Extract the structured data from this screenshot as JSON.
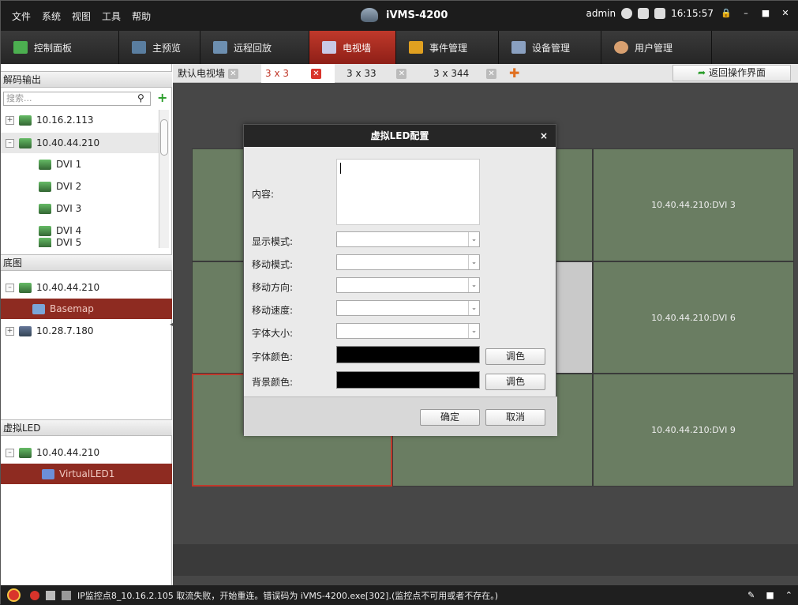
{
  "menu": [
    "文件",
    "系统",
    "视图",
    "工具",
    "帮助"
  ],
  "app_title": "iVMS-4200",
  "status": {
    "user": "admin",
    "time": "16:15:57"
  },
  "toolbar": [
    {
      "label": "控制面板"
    },
    {
      "label": "主预览"
    },
    {
      "label": "远程回放"
    },
    {
      "label": "电视墙",
      "active": true
    },
    {
      "label": "事件管理"
    },
    {
      "label": "设备管理"
    },
    {
      "label": "用户管理"
    }
  ],
  "left": {
    "decode_section": "解码输出",
    "search_placeholder": "搜索...",
    "decode_items": [
      "10.16.2.113",
      "10.40.44.210",
      "DVI 1",
      "DVI 2",
      "DVI 3",
      "DVI 4",
      "DVI 5"
    ],
    "basemap_section": "底图",
    "basemap_items": [
      "10.40.44.210",
      "Basemap",
      "10.28.7.180"
    ],
    "led_section": "虚拟LED",
    "led_items": [
      "10.40.44.210",
      "VirtualLED1"
    ]
  },
  "tabs": [
    "默认电视墙",
    "3 x 3",
    "3 x 33",
    "3 x 344"
  ],
  "back_button": "返回操作界面",
  "cells": [
    "10.40.44.210:DVI 3",
    "10.40.44.210:DVI 6",
    "10.40.44.210:DVI 9"
  ],
  "dialog": {
    "title": "虚拟LED配置",
    "content_label": "内容:",
    "display_mode": "显示模式:",
    "move_mode": "移动模式:",
    "move_direction": "移动方向:",
    "move_speed": "移动速度:",
    "font_size": "字体大小:",
    "font_color": "字体颜色:",
    "bg_color": "背景颜色:",
    "adjust_color": "调色",
    "ok": "确定",
    "cancel": "取消",
    "font_color_value": "#000000",
    "bg_color_value": "#000000"
  },
  "status_message": "IP监控点8_10.16.2.105 取流失败，开始重连。错误码为 iVMS-4200.exe[302].(监控点不可用或者不存在。)"
}
